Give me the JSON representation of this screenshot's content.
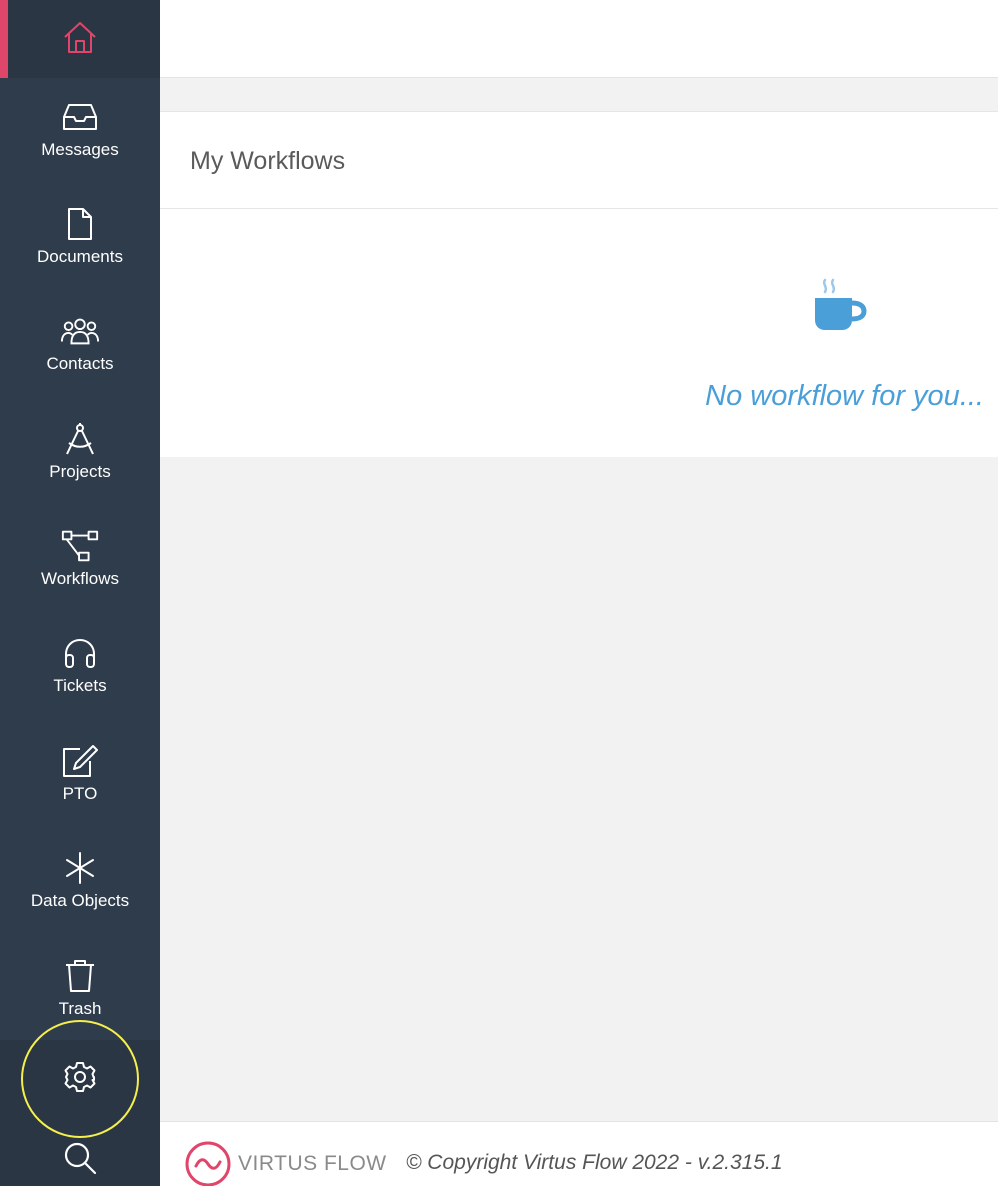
{
  "sidebar": {
    "home_icon": "home-icon",
    "accent_color": "#e0456a",
    "items": [
      {
        "label": "Messages",
        "icon": "inbox-icon"
      },
      {
        "label": "Documents",
        "icon": "document-icon"
      },
      {
        "label": "Contacts",
        "icon": "users-icon"
      },
      {
        "label": "Projects",
        "icon": "compass-icon"
      },
      {
        "label": "Workflows",
        "icon": "workflow-icon"
      },
      {
        "label": "Tickets",
        "icon": "headphones-icon"
      },
      {
        "label": "PTO",
        "icon": "edit-icon"
      },
      {
        "label": "Data Objects",
        "icon": "asterisk-icon"
      },
      {
        "label": "Trash",
        "icon": "trash-icon"
      }
    ],
    "settings_icon": "gear-icon",
    "search_icon": "search-icon"
  },
  "main": {
    "panel_title": "My Workflows",
    "empty_state": {
      "icon": "coffee-icon",
      "message": "No workflow for you...",
      "color": "#4a9fd8"
    }
  },
  "footer": {
    "logo_text": "VIRTUS FLOW",
    "copyright": "© Copyright Virtus Flow 2022 - v.2.315.1"
  }
}
